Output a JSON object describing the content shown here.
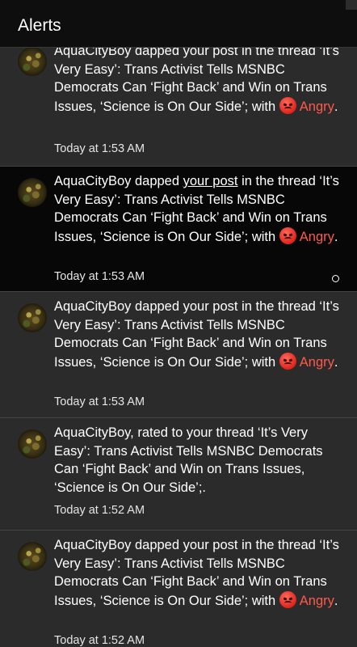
{
  "header": {
    "title": "Alerts"
  },
  "alerts": [
    {
      "before": "AquaCityBoy dapped your post in the thread ‘It’s Very Easy’: Trans Activist Tells MSNBC Democrats Can ‘Fight Back’ and Win on Trans Issues, ‘Science is On Our Side’; with ",
      "reaction": "Angry",
      "after": ".",
      "time": "Today at 1:53 AM"
    },
    {
      "pre": "AquaCityBoy dapped ",
      "link": "your post",
      "post": " in the thread ‘It’s Very Easy’: Trans Activist Tells MSNBC Democrats Can ‘Fight Back’ and Win on Trans Issues, ‘Science is On Our Side’; with ",
      "reaction": "Angry",
      "after": ".",
      "time": "Today at 1:53 AM"
    },
    {
      "before": "AquaCityBoy dapped your post in the thread ‘It’s Very Easy’: Trans Activist Tells MSNBC Democrats Can ‘Fight Back’ and Win on Trans Issues, ‘Science is On Our Side’; with ",
      "reaction": "Angry",
      "after": ".",
      "time": "Today at 1:53 AM"
    },
    {
      "before": "AquaCityBoy, rated to your thread ‘It’s Very Easy’: Trans Activist Tells MSNBC Democrats Can ‘Fight Back’ and Win on Trans Issues, ‘Science is On Our Side’;.",
      "time": "Today at 1:52 AM"
    },
    {
      "before": "AquaCityBoy dapped your post in the thread ‘It’s Very Easy’: Trans Activist Tells MSNBC Democrats Can ‘Fight Back’ and Win on Trans Issues, ‘Science is On Our Side’; with ",
      "reaction": "Angry",
      "after": ".",
      "time": "Today at 1:52 AM"
    }
  ],
  "colors": {
    "header_bg": "#0e0e0e",
    "item_bg": "#2b2b2c",
    "selected_bg": "#070707",
    "angry": "#ff5a4a"
  },
  "icons": {
    "reaction": "angry-face-icon",
    "mark_read": "circle-outline-icon"
  }
}
